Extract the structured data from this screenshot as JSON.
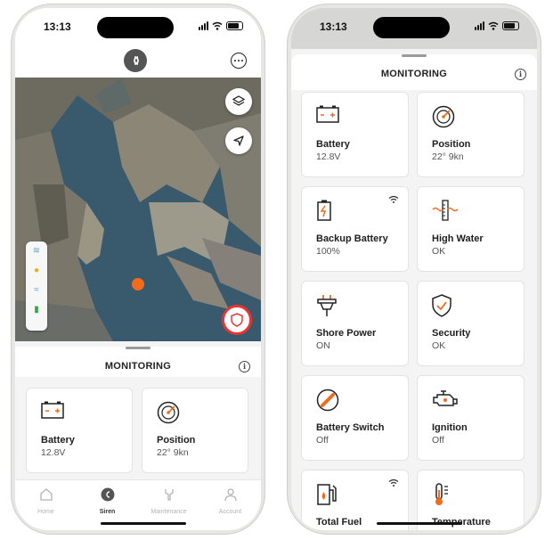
{
  "status": {
    "time": "13:13"
  },
  "left": {
    "section_title": "MONITORING",
    "cards": [
      {
        "name": "Battery",
        "value": "12.8V",
        "icon": "battery-icon"
      },
      {
        "name": "Position",
        "value": "22° 9kn",
        "icon": "compass-icon"
      }
    ],
    "tabs": [
      {
        "label": "Home",
        "icon": "home-icon",
        "active": false
      },
      {
        "label": "Siren",
        "icon": "siren-logo-icon",
        "active": true
      },
      {
        "label": "Maintenance",
        "icon": "wrench-icon",
        "active": false
      },
      {
        "label": "Account",
        "icon": "person-icon",
        "active": false
      }
    ]
  },
  "right": {
    "section_title": "MONITORING",
    "cards": [
      {
        "name": "Battery",
        "value": "12.8V",
        "icon": "battery-icon"
      },
      {
        "name": "Position",
        "value": "22° 9kn",
        "icon": "compass-icon"
      },
      {
        "name": "Backup Battery",
        "value": "100%",
        "icon": "backup-battery-icon",
        "wifi": true
      },
      {
        "name": "High Water",
        "value": "OK",
        "icon": "high-water-icon"
      },
      {
        "name": "Shore Power",
        "value": "ON",
        "icon": "shore-power-icon"
      },
      {
        "name": "Security",
        "value": "OK",
        "icon": "shield-check-icon"
      },
      {
        "name": "Battery Switch",
        "value": "Off",
        "icon": "battery-switch-icon"
      },
      {
        "name": "Ignition",
        "value": "Off",
        "icon": "engine-icon"
      },
      {
        "name": "Total Fuel",
        "value": "",
        "icon": "fuel-icon",
        "wifi": true
      },
      {
        "name": "Temperature",
        "value": "",
        "icon": "thermometer-icon"
      }
    ]
  },
  "colors": {
    "accent": "#f26b1d",
    "alert": "#ea3434",
    "text": "#1e1e1e"
  }
}
